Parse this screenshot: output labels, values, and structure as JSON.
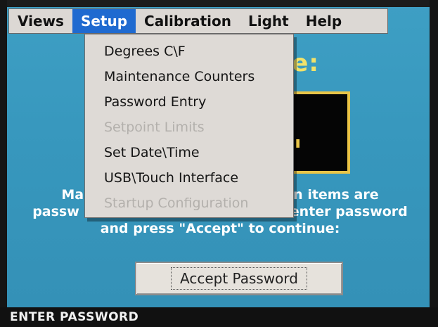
{
  "menubar": {
    "items": [
      {
        "label": "Views"
      },
      {
        "label": "Setup"
      },
      {
        "label": "Calibration"
      },
      {
        "label": "Light"
      },
      {
        "label": "Help"
      }
    ]
  },
  "setup_menu": {
    "items": [
      {
        "label": "Degrees C\\F",
        "enabled": true
      },
      {
        "label": "Maintenance Counters",
        "enabled": true
      },
      {
        "label": "Password Entry",
        "enabled": true
      },
      {
        "label": "Setpoint Limits",
        "enabled": false
      },
      {
        "label": "Set Date\\Time",
        "enabled": true
      },
      {
        "label": "USB\\Touch Interface",
        "enabled": true
      },
      {
        "label": "Startup Configuration",
        "enabled": false
      }
    ]
  },
  "screen": {
    "title_partial": "ance:",
    "instructions": {
      "line1_left": "Ma",
      "line1_right": "on items are",
      "line2_left": "passw",
      "line2_right": "enter password",
      "line3": "and press \"Accept\" to continue:"
    }
  },
  "accept_button": {
    "label": "Accept Password"
  },
  "status": {
    "text": "ENTER PASSWORD"
  },
  "colors": {
    "background": "#3797bd",
    "menu_highlight": "#1f6ad0",
    "title": "#f2e26a",
    "password_border": "#e8c447"
  }
}
